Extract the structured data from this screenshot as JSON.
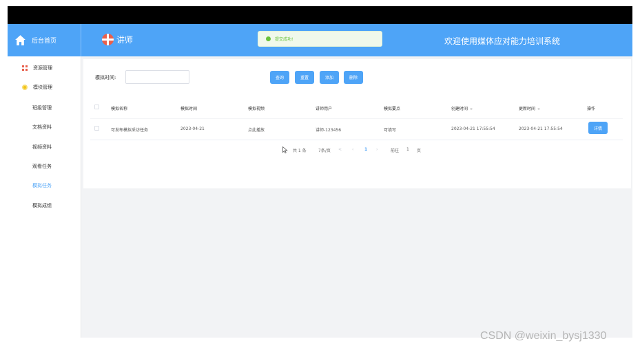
{
  "header": {
    "home_label": "后台首页",
    "brand": "讲师",
    "title": "欢迎使用媒体应对能力培训系统",
    "toast": "提交成功!"
  },
  "sidebar": {
    "items": [
      {
        "label": "资源管理",
        "icon": "grid-icon"
      },
      {
        "label": "模块管理",
        "icon": "flower-icon"
      },
      {
        "label": "班级管理"
      },
      {
        "label": "文档资料"
      },
      {
        "label": "视频资料"
      },
      {
        "label": "观看任务"
      },
      {
        "label": "模拟任务",
        "active": true
      },
      {
        "label": "模拟成绩"
      }
    ]
  },
  "filter": {
    "label": "模拟时间:",
    "value": "",
    "placeholder": ""
  },
  "buttons": {
    "query": "查询",
    "reset": "重置",
    "add": "添加",
    "delete": "删除"
  },
  "table": {
    "columns": [
      "模拟名称",
      "模拟时间",
      "模拟视频",
      "讲师用户",
      "模拟要点",
      "创建时间",
      "更新时间",
      "操作"
    ],
    "sort_mark": "≎",
    "rows": [
      {
        "name": "可发布模拟采访任务",
        "time": "2023-04-21",
        "video": "点此播放",
        "teacher": "讲师-123456",
        "points": "可填写",
        "created": "2023-04-21 17:55:54",
        "updated": "2023-04-21 17:55:54",
        "action": "详情"
      }
    ]
  },
  "pagination": {
    "total": "共 1 条",
    "page_size": "7条/页",
    "current": "1",
    "goto_label": "前往",
    "goto_value": "1",
    "page_suffix": "页"
  },
  "watermark": "CSDN @weixin_bysj1330",
  "colors": {
    "accent": "#4ea4f7",
    "success": "#67c23a"
  }
}
